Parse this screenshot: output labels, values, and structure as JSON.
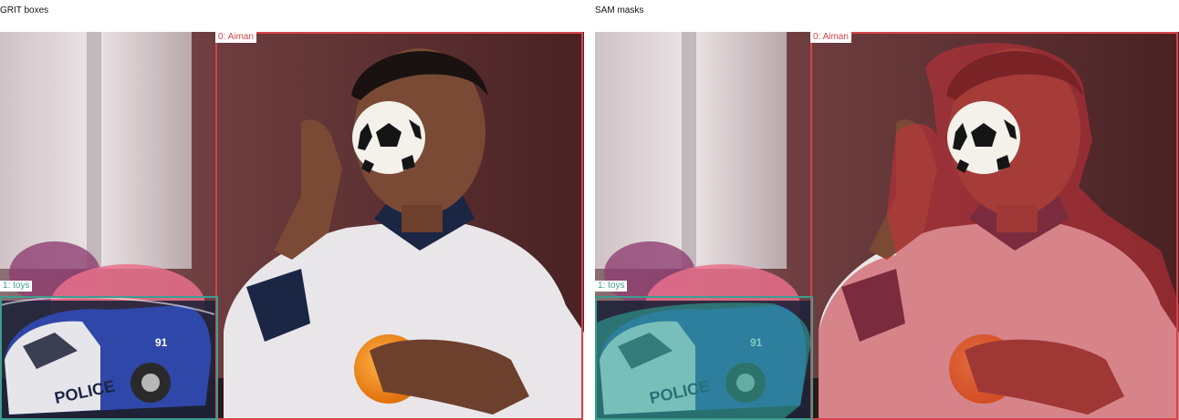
{
  "left_panel": {
    "title": "GRIT boxes"
  },
  "right_panel": {
    "title": "SAM masks"
  },
  "labels": {
    "aiman": "0: Aiman",
    "toys": "1: toys"
  },
  "photo_text": {
    "police": "POLICE",
    "car_number": "91"
  },
  "colors": {
    "aiman": "#d9434a",
    "toys": "#3c9e8f",
    "aiman_mask": "#c8323a",
    "toys_mask": "#2fa597"
  }
}
